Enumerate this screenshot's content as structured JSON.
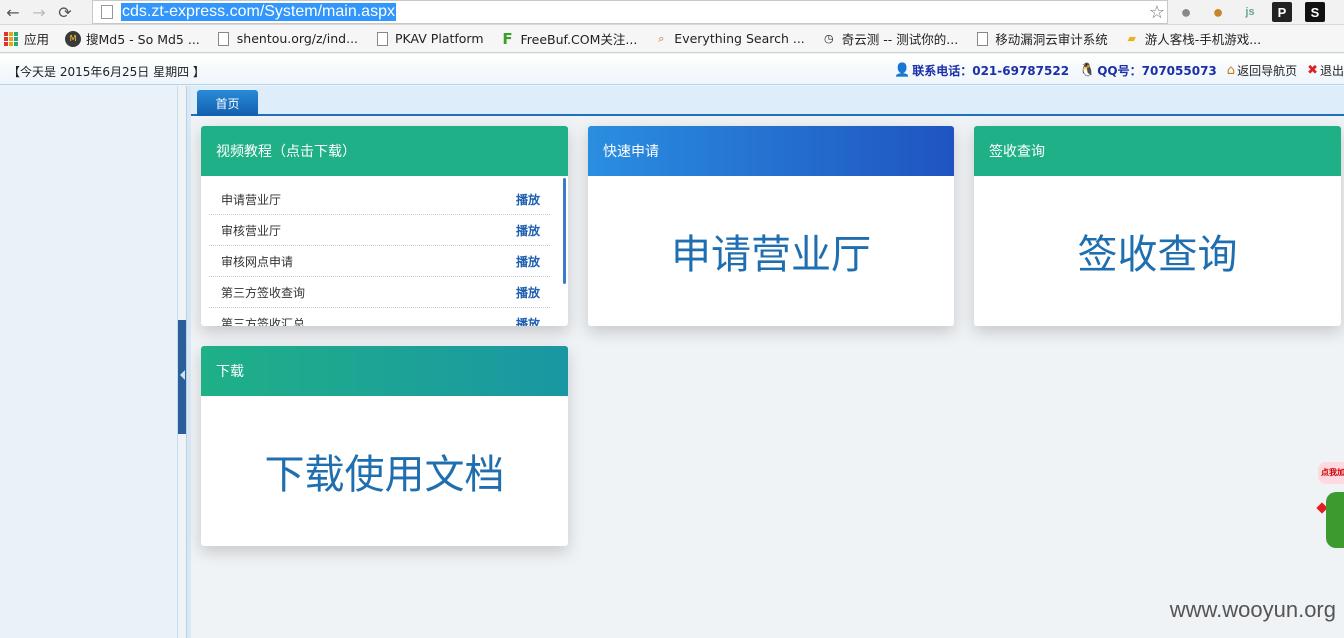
{
  "browser": {
    "url": "cds.zt-express.com/System/main.aspx",
    "nav_back": "←",
    "nav_forward": "→",
    "nav_reload": "⟳",
    "star": "☆",
    "ext_js": "js",
    "ext_p": "P",
    "ext_s": "S"
  },
  "bookmarks": [
    {
      "label": "应用",
      "icon": "apps-grid-icon"
    },
    {
      "label": "搜Md5 - So Md5 ...",
      "icon": "md5-icon"
    },
    {
      "label": "shentou.org/z/ind...",
      "icon": "page-icon"
    },
    {
      "label": "PKAV Platform",
      "icon": "page-icon"
    },
    {
      "label": "FreeBuf.COM关注...",
      "icon": "freebuf-icon"
    },
    {
      "label": "Everything Search ...",
      "icon": "search-icon"
    },
    {
      "label": "奇云测 -- 测试你的...",
      "icon": "clock-icon"
    },
    {
      "label": "移动漏洞云审计系统",
      "icon": "page-icon"
    },
    {
      "label": "游人客栈-手机游戏...",
      "icon": "folder-icon"
    }
  ],
  "infobar": {
    "date": "【今天是 2015年6月25日 星期四 】",
    "phone": "联系电话：021-69787522",
    "qq": "QQ号：707055073",
    "back_nav": "返回导航页",
    "logout": "退出"
  },
  "tabs": [
    {
      "label": "首页"
    }
  ],
  "cards": {
    "video": {
      "title": "视频教程（点击下载）",
      "items": [
        {
          "name": "申请营业厅",
          "action": "播放"
        },
        {
          "name": "审核营业厅",
          "action": "播放"
        },
        {
          "name": "审核网点申请",
          "action": "播放"
        },
        {
          "name": "第三方签收查询",
          "action": "播放"
        },
        {
          "name": "第三方签收汇总",
          "action": "播放"
        }
      ]
    },
    "quick_apply": {
      "title": "快速申请",
      "link": "申请营业厅"
    },
    "sign_query": {
      "title": "签收查询",
      "link": "签收查询"
    },
    "download": {
      "title": "下载",
      "link": "下载使用文档"
    }
  },
  "mascot": {
    "text": "点我加"
  },
  "watermark": "www.wooyun.org",
  "colors": {
    "header_green": "#1fb087",
    "header_blue": "#2a8ee0",
    "link_blue": "#1f6fb0",
    "tab_blue": "#1f70b8"
  }
}
